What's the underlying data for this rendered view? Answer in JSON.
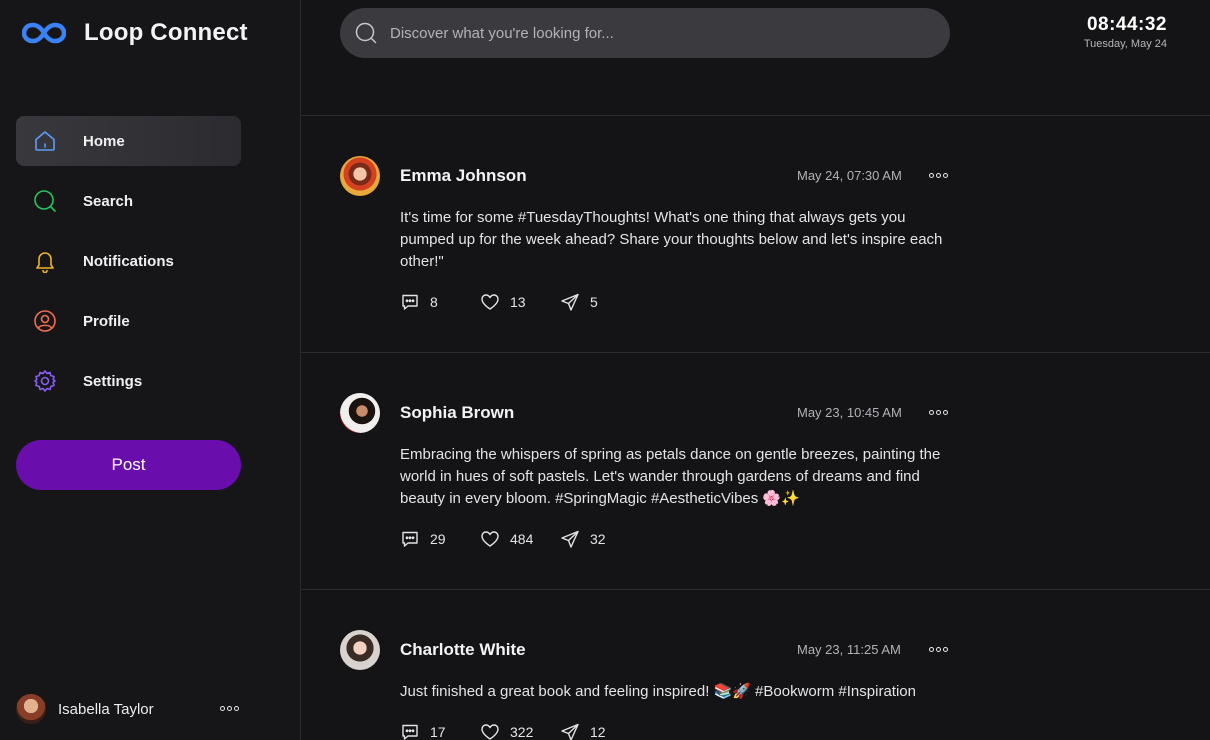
{
  "brand": {
    "name": "Loop Connect",
    "logo_icon": "infinity-logo-icon",
    "logo_color": "#3b82f6"
  },
  "nav": [
    {
      "label": "Home",
      "icon": "home-icon",
      "color": "#5b9cf6",
      "active": true
    },
    {
      "label": "Search",
      "icon": "search-icon",
      "color": "#22c55e",
      "active": false
    },
    {
      "label": "Notifications",
      "icon": "bell-icon",
      "color": "#f0b429",
      "active": false
    },
    {
      "label": "Profile",
      "icon": "user-circle-icon",
      "color": "#f26d4f",
      "active": false
    },
    {
      "label": "Settings",
      "icon": "gear-icon",
      "color": "#8b5cf6",
      "active": false
    }
  ],
  "post_button": {
    "label": "Post",
    "color": "#6a0dad"
  },
  "current_user": {
    "name": "Isabella Taylor"
  },
  "search": {
    "placeholder": "Discover what you're looking for..."
  },
  "clock": {
    "time": "08:44:32",
    "date": "Tuesday, May 24"
  },
  "posts": [
    {
      "author": "Emma Johnson",
      "time": "May 24, 07:30 AM",
      "text": "It's time for some #TuesdayThoughts! What's one thing that always gets you pumped up for the week ahead? Share your thoughts below and let's inspire each other!\"",
      "comments": "8",
      "likes": "13",
      "shares": "5"
    },
    {
      "author": "Sophia Brown",
      "time": "May 23, 10:45 AM",
      "text": "Embracing the whispers of spring as petals dance on gentle breezes, painting the world in hues of soft pastels. Let's wander through gardens of dreams and find beauty in every bloom. #SpringMagic #AestheticVibes 🌸✨",
      "comments": "29",
      "likes": "484",
      "shares": "32"
    },
    {
      "author": "Charlotte White",
      "time": "May 23, 11:25 AM",
      "text": "Just finished a great book and feeling inspired! 📚🚀 #Bookworm #Inspiration",
      "comments": "17",
      "likes": "322",
      "shares": "12"
    }
  ]
}
